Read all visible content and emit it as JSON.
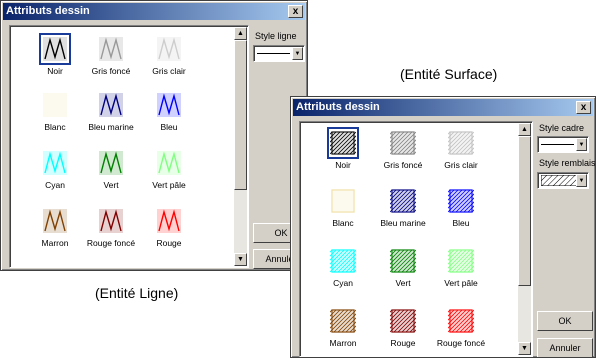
{
  "captions": {
    "surface": "(Entité Surface)",
    "ligne": "(Entité Ligne)"
  },
  "dialog_ligne": {
    "title": "Attributs dessin",
    "close": "x",
    "style_label": "Style ligne",
    "ok": "OK",
    "cancel": "Annuler",
    "colors": [
      {
        "name": "Noir",
        "color": "#000000"
      },
      {
        "name": "Gris foncé",
        "color": "#808080"
      },
      {
        "name": "Gris clair",
        "color": "#c0c0c0"
      },
      {
        "name": "Blanc",
        "color": "#ffffff"
      },
      {
        "name": "Bleu marine",
        "color": "#000080"
      },
      {
        "name": "Bleu",
        "color": "#0000ff"
      },
      {
        "name": "Cyan",
        "color": "#00ffff"
      },
      {
        "name": "Vert",
        "color": "#008000"
      },
      {
        "name": "Vert pâle",
        "color": "#80ff80"
      },
      {
        "name": "Marron",
        "color": "#804000"
      },
      {
        "name": "Rouge foncé",
        "color": "#800000"
      },
      {
        "name": "Rouge",
        "color": "#ff0000"
      }
    ]
  },
  "dialog_surface": {
    "title": "Attributs dessin",
    "close": "x",
    "style_cadre_label": "Style cadre",
    "style_remblais_label": "Style remblais",
    "ok": "OK",
    "cancel": "Annuler",
    "colors": [
      {
        "name": "Noir",
        "color": "#000000"
      },
      {
        "name": "Gris foncé",
        "color": "#808080"
      },
      {
        "name": "Gris clair",
        "color": "#c0c0c0"
      },
      {
        "name": "Blanc",
        "color": "#ffffff"
      },
      {
        "name": "Bleu marine",
        "color": "#000080"
      },
      {
        "name": "Bleu",
        "color": "#0000ff"
      },
      {
        "name": "Cyan",
        "color": "#00ffff"
      },
      {
        "name": "Vert",
        "color": "#008000"
      },
      {
        "name": "Vert pâle",
        "color": "#80ff80"
      },
      {
        "name": "Marron",
        "color": "#804000"
      },
      {
        "name": "Rouge",
        "color": "#800000"
      },
      {
        "name": "Rouge foncé",
        "color": "#ff0000"
      }
    ]
  }
}
